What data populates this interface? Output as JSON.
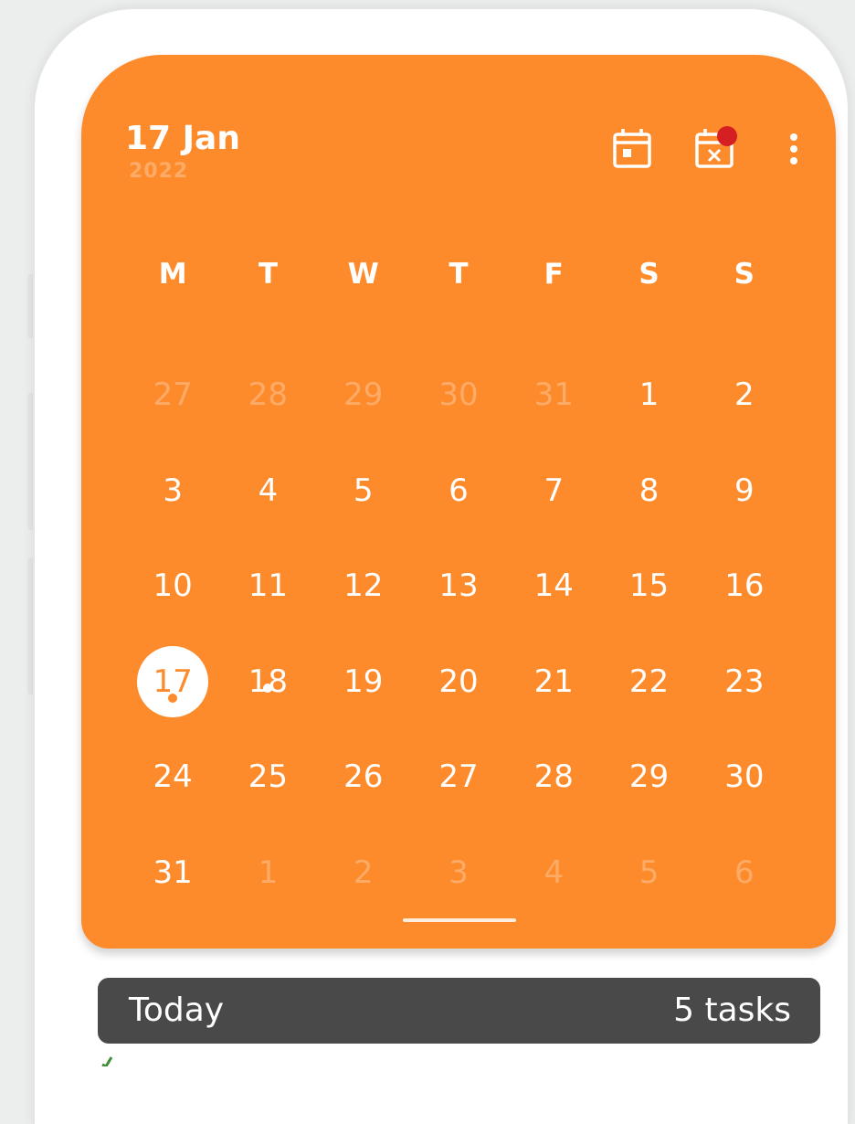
{
  "header": {
    "date": "17 Jan",
    "year": "2022",
    "colors": {
      "accent": "#fd8b2b",
      "notification": "#d51f22",
      "bar": "#494949"
    }
  },
  "calendar": {
    "weekdays": [
      "M",
      "T",
      "W",
      "T",
      "F",
      "S",
      "S"
    ],
    "weeks": [
      [
        {
          "d": "27",
          "m": true
        },
        {
          "d": "28",
          "m": true
        },
        {
          "d": "29",
          "m": true
        },
        {
          "d": "30",
          "m": true
        },
        {
          "d": "31",
          "m": true
        },
        {
          "d": "1"
        },
        {
          "d": "2"
        }
      ],
      [
        {
          "d": "3"
        },
        {
          "d": "4"
        },
        {
          "d": "5"
        },
        {
          "d": "6"
        },
        {
          "d": "7"
        },
        {
          "d": "8"
        },
        {
          "d": "9"
        }
      ],
      [
        {
          "d": "10"
        },
        {
          "d": "11"
        },
        {
          "d": "12"
        },
        {
          "d": "13"
        },
        {
          "d": "14"
        },
        {
          "d": "15"
        },
        {
          "d": "16"
        }
      ],
      [
        {
          "d": "17",
          "sel": true,
          "dot": true
        },
        {
          "d": "18",
          "dot": true
        },
        {
          "d": "19"
        },
        {
          "d": "20"
        },
        {
          "d": "21"
        },
        {
          "d": "22"
        },
        {
          "d": "23"
        }
      ],
      [
        {
          "d": "24"
        },
        {
          "d": "25"
        },
        {
          "d": "26"
        },
        {
          "d": "27"
        },
        {
          "d": "28"
        },
        {
          "d": "29"
        },
        {
          "d": "30"
        }
      ],
      [
        {
          "d": "31"
        },
        {
          "d": "1",
          "m": true
        },
        {
          "d": "2",
          "m": true
        },
        {
          "d": "3",
          "m": true
        },
        {
          "d": "4",
          "m": true
        },
        {
          "d": "5",
          "m": true
        },
        {
          "d": "6",
          "m": true
        }
      ]
    ]
  },
  "today_bar": {
    "label": "Today",
    "count": "5 tasks"
  },
  "icons": {
    "calendar": "calendar-icon",
    "calendar_remove": "calendar-remove-icon",
    "more": "more-vertical-icon",
    "check": "check-icon"
  }
}
